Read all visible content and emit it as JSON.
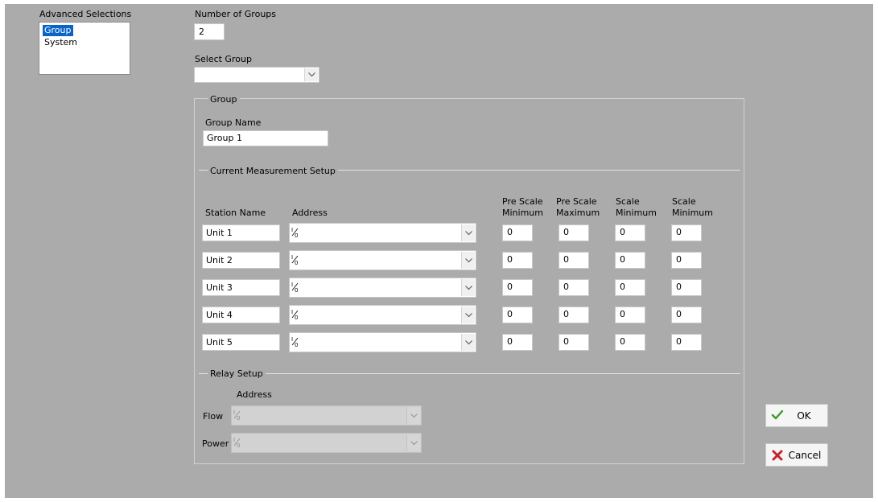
{
  "advanced_selections": {
    "label": "Advanced Selections",
    "items": [
      {
        "label": "Group",
        "selected": true
      },
      {
        "label": "System",
        "selected": false
      }
    ]
  },
  "number_of_groups": {
    "label": "Number of Groups",
    "value": "2"
  },
  "select_group": {
    "label": "Select Group",
    "value": ""
  },
  "group": {
    "caption": "Group",
    "group_name_label": "Group Name",
    "group_name_value": "Group 1"
  },
  "current_setup": {
    "caption": "Current Measurement Setup",
    "headers": {
      "station_name": "Station Name",
      "address": "Address",
      "pre_scale_min": "Pre Scale\nMinimum",
      "pre_scale_max": "Pre Scale\nMaximum",
      "scale_min": "Scale\nMinimum",
      "scale_min2": "Scale\nMinimum"
    },
    "rows": [
      {
        "station": "Unit 1",
        "address": "",
        "pre_min": "0",
        "pre_max": "0",
        "scale_min": "0",
        "scale_min2": "0"
      },
      {
        "station": "Unit 2",
        "address": "",
        "pre_min": "0",
        "pre_max": "0",
        "scale_min": "0",
        "scale_min2": "0"
      },
      {
        "station": "Unit 3",
        "address": "",
        "pre_min": "0",
        "pre_max": "0",
        "scale_min": "0",
        "scale_min2": "0"
      },
      {
        "station": "Unit 4",
        "address": "",
        "pre_min": "0",
        "pre_max": "0",
        "scale_min": "0",
        "scale_min2": "0"
      },
      {
        "station": "Unit 5",
        "address": "",
        "pre_min": "0",
        "pre_max": "0",
        "scale_min": "0",
        "scale_min2": "0"
      }
    ]
  },
  "relay_setup": {
    "caption": "Relay Setup",
    "address_label": "Address",
    "flow_label": "Flow",
    "power_label": "Power"
  },
  "buttons": {
    "ok_label": "OK",
    "cancel_label": "Cancel"
  },
  "icons": {
    "io_icon": "io-name-icon",
    "ok_icon": "green-check-icon",
    "cancel_icon": "red-x-icon",
    "dropdown_icon": "chevron-down-icon"
  },
  "colors": {
    "panel_bg": "#ababab",
    "selection": "#0a64c8",
    "ok_check": "#3a9a2a",
    "cancel_x": "#c8232c"
  }
}
